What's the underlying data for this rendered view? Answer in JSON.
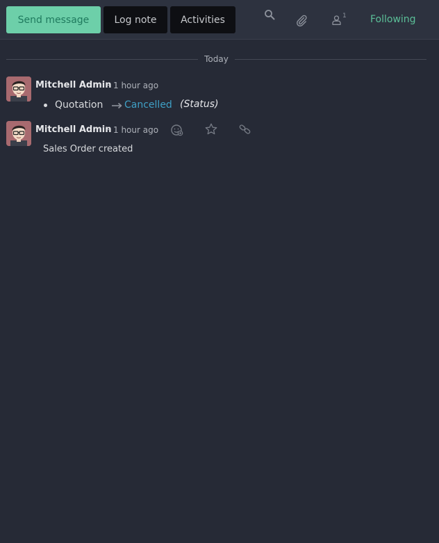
{
  "chatter": {
    "buttons": {
      "send_message": "Send message",
      "log_note": "Log note",
      "activities": "Activities"
    },
    "topbar_icons": {
      "search": "search-icon",
      "attachments": "paperclip-icon",
      "followers": "user-icon"
    },
    "followers_count": "1",
    "following_label": "Following",
    "accent_color": "#6dcfa9",
    "link_color": "#3fa0c6"
  },
  "thread": {
    "date_separator": "Today",
    "messages": [
      {
        "author": "Mitchell Admin",
        "separator": "-",
        "time": "1 hour ago",
        "tracking": {
          "field": "Quotation",
          "arrow": "long-arrow-right-icon",
          "new_value": "Cancelled",
          "field_label": "(Status)"
        }
      },
      {
        "author": "Mitchell Admin",
        "separator": "-",
        "time": "1 hour ago",
        "body": "Sales Order created",
        "actions": [
          "add-reaction-icon",
          "star-icon",
          "link-icon"
        ]
      }
    ]
  }
}
